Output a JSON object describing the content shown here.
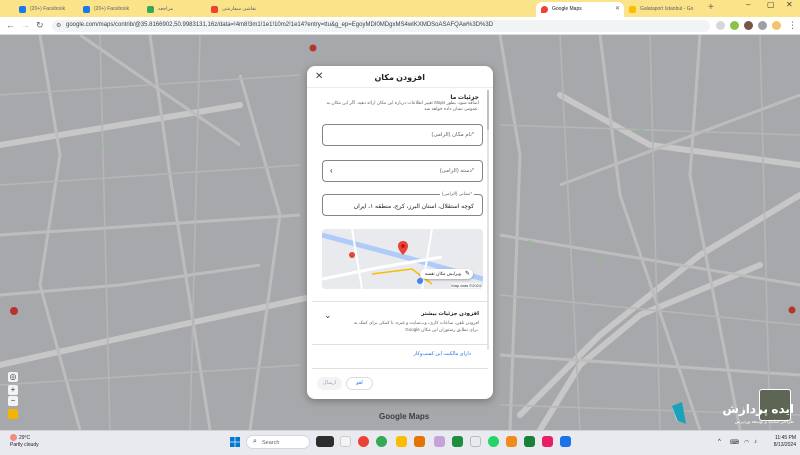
{
  "browser": {
    "tabs": [
      {
        "label": "(20+) Facebook",
        "color": "#1877f2",
        "active": false
      },
      {
        "label": "(20+) Facebook",
        "color": "#1877f2",
        "active": false
      },
      {
        "label": "مراجعه",
        "color": "#34a853",
        "active": false
      },
      {
        "label": "نقاشی سفارشی",
        "color": "#ea4335",
        "active": false
      },
      {
        "label": "Google Maps",
        "color": "#ea4335",
        "active": true
      },
      {
        "label": "Galataport Istanbul - Go",
        "color": "#fbbc04",
        "active": false
      }
    ],
    "url": "google.com/maps/contrib/@35.8166902,50.9983131,16z/data=!4m8!3m1!1e1!10m2!1e14?entry=ttu&g_ep=EgoyMDI0MDgxMS4wIKXMDSoASAFQAw%3D%3D"
  },
  "dialog": {
    "title": "افزودن مکان",
    "details_title": "جزئیات ما",
    "details_desc": "تغییر اطلاعات درباره این مکان ارائه دهید. اگر این مکان به Maps اضافه شود، بطور عمومی نشان داده خواهد شد.",
    "name_placeholder": "نام مکان (الزامی)*",
    "category_placeholder": "دسته (الزامی)*",
    "address_label": "نشانی (الزامی)*",
    "address_value": "کوچه استقلال، استان البرز، کرج، منطقه ۱، ایران",
    "map_edit_label": "ویرایش مکان نقشه",
    "map_attribution": "Map data ©2024",
    "more_title": "افزودن جزئیات بیشتر",
    "more_desc": "افزودن تلفن، ساعات کاری، وب‌سایت و غیره، تا کمکی برای کمک به Google برای تطابق رستوران این مکان.",
    "owner_link": "دارای مالکیت این کسب‌وکار",
    "cancel_label": "لغو",
    "submit_label": "ارسال"
  },
  "map": {
    "logo": "Google Maps"
  },
  "watermark": {
    "title": "ایده پردازش",
    "subtitle": "طراحی سایت و توسعه وردپرس"
  },
  "taskbar": {
    "weather_temp": "29°C",
    "weather_desc": "Partly cloudy",
    "search_placeholder": "Search",
    "time": "11:45 PM",
    "date": "8/13/2024"
  }
}
